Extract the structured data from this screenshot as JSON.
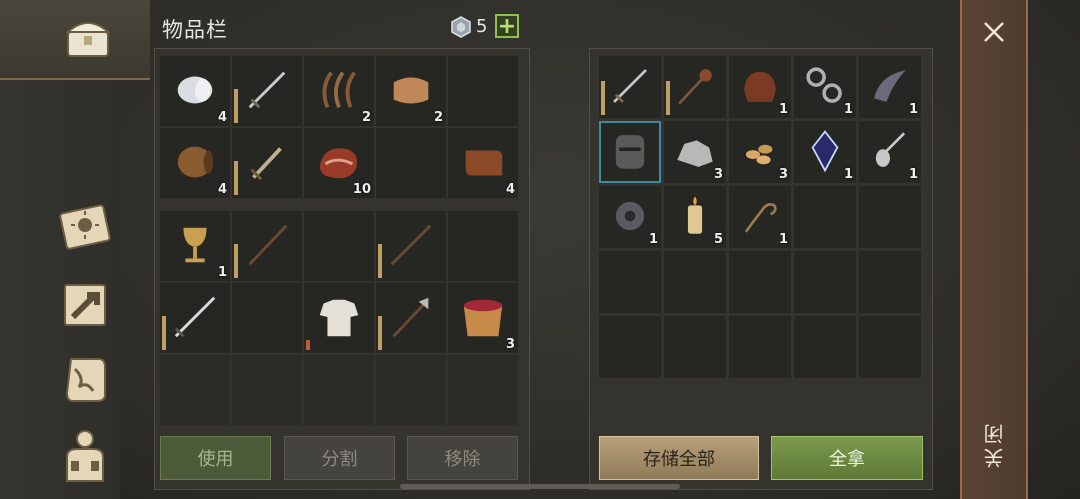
{
  "inventory": {
    "title": "物品栏",
    "currency_count": "5",
    "plus_label": "+",
    "top_grid": [
      {
        "icon": "cloth-roll-icon",
        "count": "4"
      },
      {
        "icon": "sword-icon",
        "count": ""
      },
      {
        "icon": "fiber-icon",
        "count": "2"
      },
      {
        "icon": "leather-icon",
        "count": "2"
      },
      {
        "icon": "",
        "count": ""
      },
      {
        "icon": "barrel-icon",
        "count": "4"
      },
      {
        "icon": "short-sword-icon",
        "count": ""
      },
      {
        "icon": "raw-meat-icon",
        "count": "10"
      },
      {
        "icon": "",
        "count": ""
      },
      {
        "icon": "hide-scroll-icon",
        "count": "4"
      }
    ],
    "bottom_grid": [
      {
        "icon": "goblet-icon",
        "count": "1"
      },
      {
        "icon": "staff-icon",
        "count": ""
      },
      {
        "icon": "",
        "count": ""
      },
      {
        "icon": "long-staff-icon",
        "count": ""
      },
      {
        "icon": "",
        "count": ""
      },
      {
        "icon": "longsword-icon",
        "count": ""
      },
      {
        "icon": "",
        "count": ""
      },
      {
        "icon": "shirt-icon",
        "count": ""
      },
      {
        "icon": "halberd-icon",
        "count": ""
      },
      {
        "icon": "berry-bucket-icon",
        "count": "3"
      },
      {
        "icon": "",
        "count": ""
      },
      {
        "icon": "",
        "count": ""
      },
      {
        "icon": "",
        "count": ""
      },
      {
        "icon": "",
        "count": ""
      },
      {
        "icon": "",
        "count": ""
      }
    ],
    "buttons": {
      "use": "使用",
      "split": "分割",
      "remove": "移除"
    }
  },
  "storage": {
    "grid": [
      {
        "icon": "sword-icon",
        "count": ""
      },
      {
        "icon": "mace-icon",
        "count": ""
      },
      {
        "icon": "saddle-icon",
        "count": "1"
      },
      {
        "icon": "chains-icon",
        "count": "1"
      },
      {
        "icon": "horn-icon",
        "count": "1"
      },
      {
        "icon": "helmet-icon",
        "count": ""
      },
      {
        "icon": "ore-icon",
        "count": "3"
      },
      {
        "icon": "seeds-icon",
        "count": "3"
      },
      {
        "icon": "crystal-icon",
        "count": "1"
      },
      {
        "icon": "spoon-icon",
        "count": "1"
      },
      {
        "icon": "gear-icon",
        "count": "1"
      },
      {
        "icon": "candle-icon",
        "count": "5"
      },
      {
        "icon": "rope-icon",
        "count": "1"
      },
      {
        "icon": "",
        "count": ""
      },
      {
        "icon": "",
        "count": ""
      },
      {
        "icon": "",
        "count": ""
      },
      {
        "icon": "",
        "count": ""
      },
      {
        "icon": "",
        "count": ""
      },
      {
        "icon": "",
        "count": ""
      },
      {
        "icon": "",
        "count": ""
      },
      {
        "icon": "",
        "count": ""
      },
      {
        "icon": "",
        "count": ""
      },
      {
        "icon": "",
        "count": ""
      },
      {
        "icon": "",
        "count": ""
      },
      {
        "icon": "",
        "count": ""
      }
    ],
    "buttons": {
      "store_all": "存储全部",
      "take_all": "全拿"
    }
  },
  "close": {
    "label": "关闭"
  },
  "colors": {
    "accent_green": "#7c9a4e",
    "accent_tan": "#b8a07a",
    "close_bar": "#5a4436",
    "selected_outline": "#3e8aa0"
  }
}
